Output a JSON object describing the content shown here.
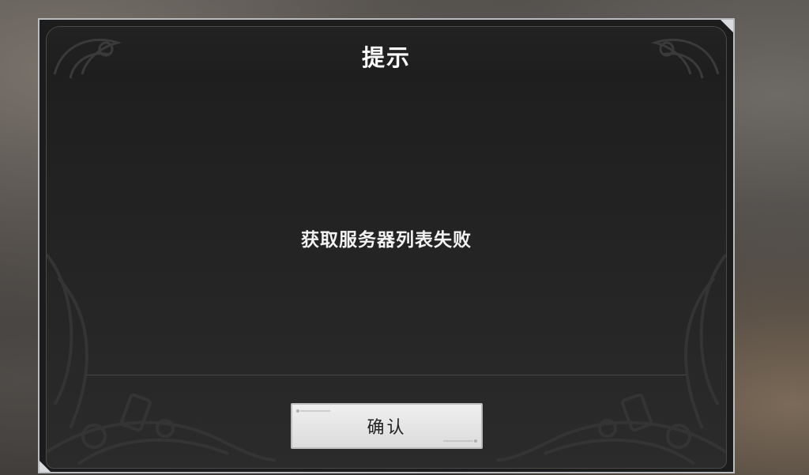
{
  "dialog": {
    "title": "提示",
    "message": "获取服务器列表失败",
    "confirm_label": "确认"
  },
  "colors": {
    "frame_border": "#b9bcc0",
    "panel_bg": "#1c1c1c",
    "button_bg": "#e6e6e6",
    "text": "#ffffff"
  }
}
